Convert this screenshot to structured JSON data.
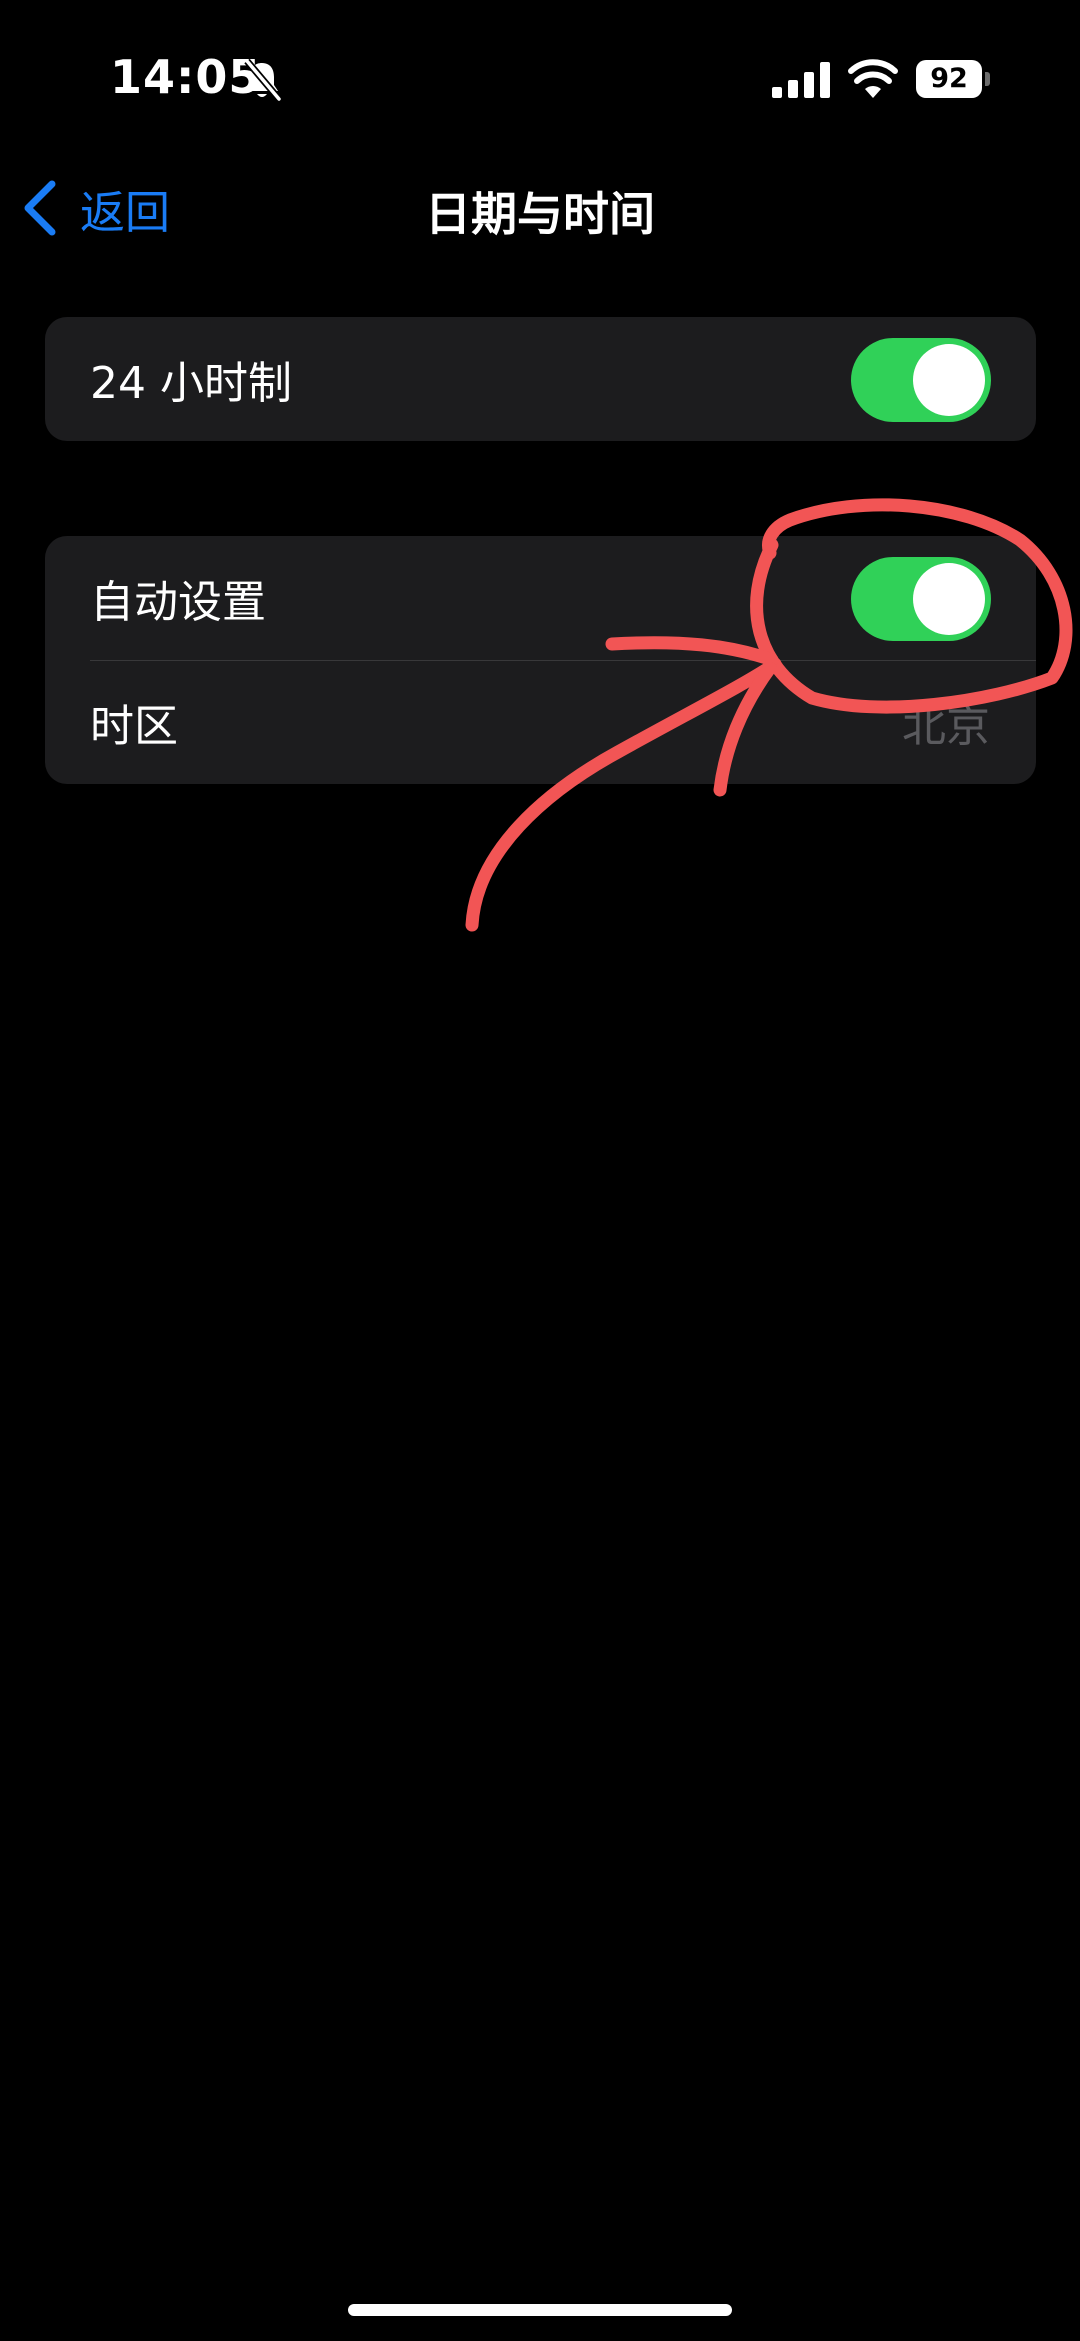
{
  "status_bar": {
    "time": "14:05",
    "battery": "92",
    "icons": [
      "bell-off-icon",
      "signal-icon",
      "wifi-icon",
      "battery-icon"
    ]
  },
  "nav": {
    "back_label": "返回",
    "back_icon": "chevron-left-icon",
    "title": "日期与时间"
  },
  "groups": [
    {
      "rows": [
        {
          "label": "24 小时制",
          "control": "toggle",
          "on": true
        }
      ]
    },
    {
      "rows": [
        {
          "label": "自动设置",
          "control": "toggle",
          "on": true
        },
        {
          "label": "时区",
          "control": "value",
          "value": "北京"
        }
      ]
    }
  ],
  "colors": {
    "background": "#000000",
    "group_background": "#1c1c1e",
    "accent_blue": "#1a7cf5",
    "toggle_on": "#30d158",
    "secondary_text": "#5a5a5e",
    "annotation": "#f25555"
  },
  "annotation": {
    "kind": "handwritten circle and arrow",
    "target": "自动设置 toggle"
  }
}
